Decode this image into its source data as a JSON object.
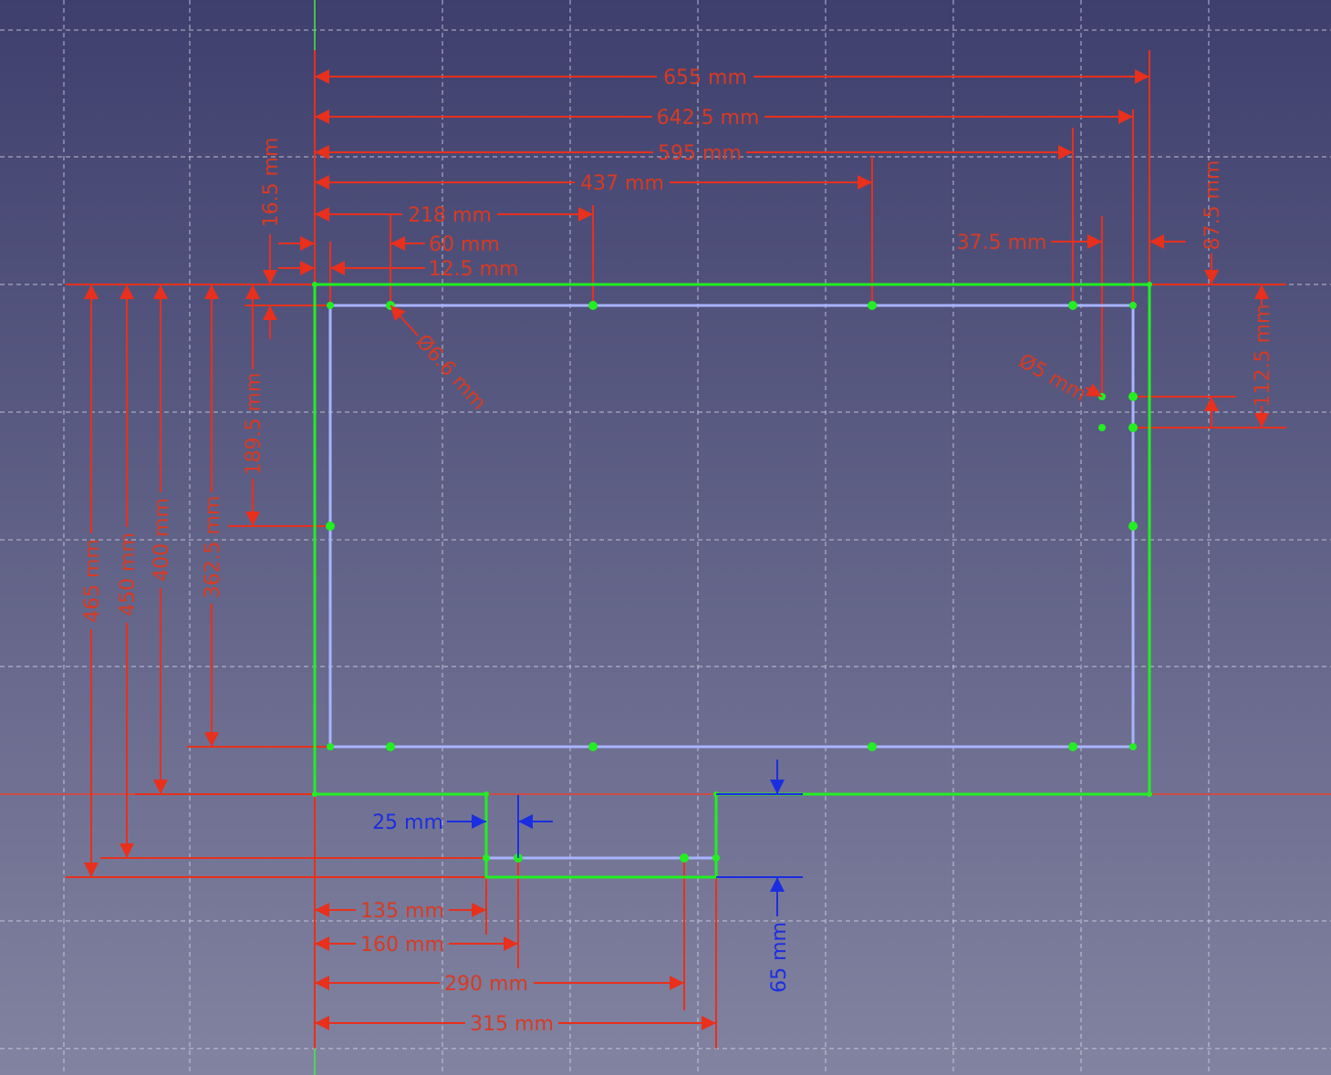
{
  "app": "Sketcher view",
  "colors": {
    "dimension": "#e8301c",
    "driven_dimension": "#1a2ee0",
    "geometry": "#22ee22",
    "construction": "#a8b4ff",
    "bg_top": "#3e3f6d",
    "bg_bottom": "#8283a0"
  },
  "dimensions": {
    "d655": "655 mm",
    "d642_5": "642.5 mm",
    "d595": "595 mm",
    "d437": "437 mm",
    "d218": "218 mm",
    "d60": "60 mm",
    "d12_5": "12.5 mm",
    "d16_5": "16.5 mm",
    "d37_5": "37.5 mm",
    "d87_5": "87.5 mm",
    "d112_5": "112.5 mm",
    "dia6_6": "Ø6.6 mm",
    "dia5": "Ø5 mm",
    "d465": "465 mm",
    "d450": "450 mm",
    "d400": "400 mm",
    "d362_5": "362.5 mm",
    "d189_5": "189.5 mm",
    "d135": "135 mm",
    "d160": "160 mm",
    "d290": "290 mm",
    "d315": "315 mm",
    "d25": "25 mm",
    "d65": "65 mm"
  }
}
